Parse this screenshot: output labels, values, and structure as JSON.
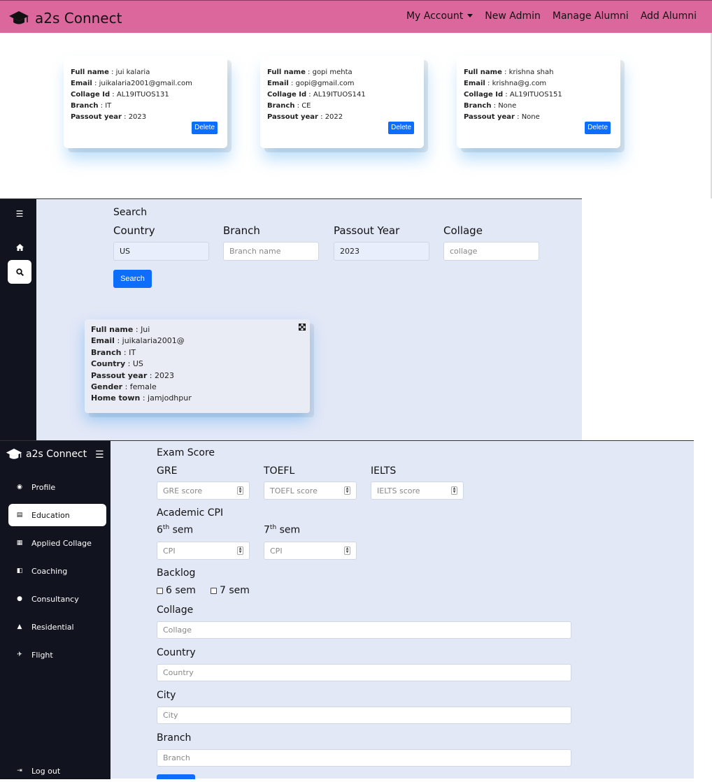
{
  "admin": {
    "brand": "a2s Connect",
    "nav": [
      "My Account",
      "New Admin",
      "Manage Alumni",
      "Add Alumni"
    ],
    "field_labels": {
      "full_name": "Full name",
      "email": "Email",
      "collage_id": "Collage Id",
      "branch": "Branch",
      "passout_year": "Passout year"
    },
    "delete_label": "Delete",
    "cards": [
      {
        "full_name": "jui kalaria",
        "email": "juikalaria2001@gmail.com",
        "collage_id": "AL19ITUOS131",
        "branch": "IT",
        "passout_year": "2023"
      },
      {
        "full_name": "gopi mehta",
        "email": "gopi@gmail.com",
        "collage_id": "AL19ITUOS141",
        "branch": "CE",
        "passout_year": "2022"
      },
      {
        "full_name": "krishna shah",
        "email": "krishna@g.com",
        "collage_id": "AL19ITUOS151",
        "branch": "None",
        "passout_year": "None"
      }
    ]
  },
  "search": {
    "title": "Search",
    "country_label": "Country",
    "country_value": "US",
    "branch_label": "Branch",
    "branch_placeholder": "Branch name",
    "year_label": "Passout Year",
    "year_value": "2023",
    "collage_label": "Collage",
    "collage_placeholder": "collage",
    "button": "Search",
    "result": {
      "labels": [
        "Full name",
        "Email",
        "Branch",
        "Country",
        "Passout year",
        "Gender",
        "Home town"
      ],
      "values": [
        "Jui",
        "juikalaria2001@",
        "IT",
        "US",
        "2023",
        "female",
        "jamjodhpur"
      ]
    }
  },
  "education": {
    "brand": "a2s Connect",
    "menu": [
      "Profile",
      "Education",
      "Applied Collage",
      "Coaching",
      "Consultancy",
      "Residential",
      "Flight"
    ],
    "logout": "Log out",
    "exam_title": "Exam Score",
    "gre_label": "GRE",
    "gre_placeholder": "GRE score",
    "toefl_label": "TOEFL",
    "toefl_placeholder": "TOEFL score",
    "ielts_label": "IELTS",
    "ielts_placeholder": "IELTS score",
    "cpi_title": "Academic CPI",
    "sem6_num": "6",
    "sem6_sup": "th",
    "sem6_word": " sem",
    "sem7_num": "7",
    "sem7_sup": "th",
    "sem7_word": " sem",
    "cpi_placeholder": "CPI",
    "backlog_title": "Backlog",
    "backlog_6": "6 sem",
    "backlog_7": "7 sem",
    "collage_label": "Collage",
    "collage_placeholder": "Collage",
    "country_label": "Country",
    "country_placeholder": "Country",
    "city_label": "City",
    "city_placeholder": "City",
    "branch_label": "Branch",
    "branch_placeholder": "Branch"
  }
}
